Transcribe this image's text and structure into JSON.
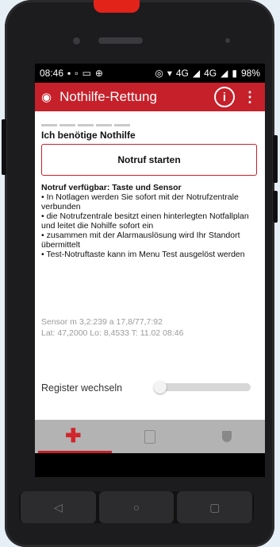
{
  "status_bar": {
    "time": "08:46",
    "left_icons": [
      "image-icon",
      "message-icon",
      "cast-icon",
      "plus-circle-icon"
    ],
    "network": "4G",
    "network2": "4G",
    "battery": "98%"
  },
  "app_bar": {
    "title": "Nothilfe-Rettung",
    "background_color": "#c6202a"
  },
  "content": {
    "section_title": "Ich benötige Nothilfe",
    "notruf_button_label": "Notruf starten",
    "info_heading": "Notruf verfügbar: Taste und Sensor",
    "info_items": [
      "• In Notlagen werden Sie sofort mit der Notrufzentrale verbunden",
      "• die Notrufzentrale besitzt einen hinterlegten Notfallplan und leitet die Nohilfe sofort ein",
      "• zusammen mit der Alarmauslösung wird Ihr Standort übermittelt",
      "• Test-Notruftaste kann im Menu Test ausgelöst werden"
    ],
    "sensor_line1": "Sensor m 3,2:239  a 17,8/77,7:92",
    "sensor_line2": "Lat: 47,2000 Lo: 8,4533 T: 11.02 08:46",
    "register_label": "Register wechseln"
  },
  "tabs": [
    {
      "icon": "red-cross-icon",
      "active": true
    },
    {
      "icon": "clipboard-icon",
      "active": false
    },
    {
      "icon": "shield-icon",
      "active": false
    }
  ],
  "nav_buttons": [
    {
      "icon": "back-triangle-icon",
      "glyph": "◁"
    },
    {
      "icon": "home-circle-icon",
      "glyph": "○"
    },
    {
      "icon": "recents-square-icon",
      "glyph": "▢"
    }
  ]
}
